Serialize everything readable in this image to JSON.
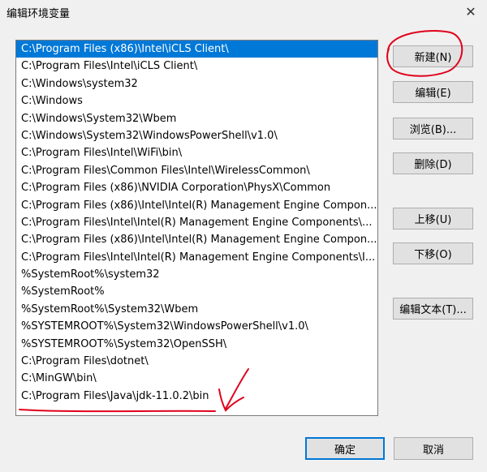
{
  "window": {
    "title": "编辑环境变量",
    "close_glyph": "✕"
  },
  "list": {
    "selected_index": 0,
    "items": [
      "C:\\Program Files (x86)\\Intel\\iCLS Client\\",
      "C:\\Program Files\\Intel\\iCLS Client\\",
      "C:\\Windows\\system32",
      "C:\\Windows",
      "C:\\Windows\\System32\\Wbem",
      "C:\\Windows\\System32\\WindowsPowerShell\\v1.0\\",
      "C:\\Program Files\\Intel\\WiFi\\bin\\",
      "C:\\Program Files\\Common Files\\Intel\\WirelessCommon\\",
      "C:\\Program Files (x86)\\NVIDIA Corporation\\PhysX\\Common",
      "C:\\Program Files (x86)\\Intel\\Intel(R) Management Engine Compon...",
      "C:\\Program Files\\Intel\\Intel(R) Management Engine Components\\...",
      "C:\\Program Files (x86)\\Intel\\Intel(R) Management Engine Compon...",
      "C:\\Program Files\\Intel\\Intel(R) Management Engine Components\\I...",
      "%SystemRoot%\\system32",
      "%SystemRoot%",
      "%SystemRoot%\\System32\\Wbem",
      "%SYSTEMROOT%\\System32\\WindowsPowerShell\\v1.0\\",
      "%SYSTEMROOT%\\System32\\OpenSSH\\",
      "C:\\Program Files\\dotnet\\",
      "C:\\MinGW\\bin\\",
      "C:\\Program Files\\Java\\jdk-11.0.2\\bin"
    ]
  },
  "buttons": {
    "new": "新建(N)",
    "edit": "编辑(E)",
    "browse": "浏览(B)...",
    "delete": "删除(D)",
    "move_up": "上移(U)",
    "move_down": "下移(O)",
    "edit_text": "编辑文本(T)...",
    "ok": "确定",
    "cancel": "取消"
  },
  "annotations": {
    "color": "#e0001b"
  }
}
